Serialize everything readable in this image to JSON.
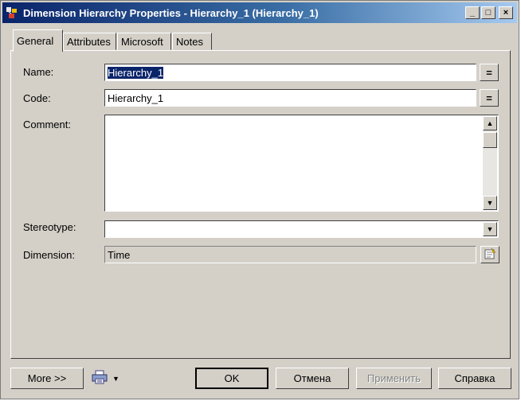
{
  "window": {
    "title": "Dimension Hierarchy Properties - Hierarchy_1 (Hierarchy_1)",
    "controls": {
      "minimize": "_",
      "maximize": "□",
      "close": "×"
    }
  },
  "tabs": [
    {
      "label": "General",
      "active": true
    },
    {
      "label": "Attributes",
      "active": false
    },
    {
      "label": "Microsoft",
      "active": false
    },
    {
      "label": "Notes",
      "active": false
    }
  ],
  "form": {
    "name": {
      "label": "Name:",
      "value": "Hierarchy_1",
      "button": "="
    },
    "code": {
      "label": "Code:",
      "value": "Hierarchy_1",
      "button": "="
    },
    "comment": {
      "label": "Comment:",
      "value": ""
    },
    "stereotype": {
      "label": "Stereotype:",
      "value": ""
    },
    "dimension": {
      "label": "Dimension:",
      "value": "Time"
    }
  },
  "footer": {
    "more": "More >>",
    "ok": "OK",
    "cancel": "Отмена",
    "apply": "Применить",
    "help": "Справка"
  },
  "icons": {
    "app": "app-icon",
    "printer": "printer-icon",
    "properties": "properties-icon"
  }
}
